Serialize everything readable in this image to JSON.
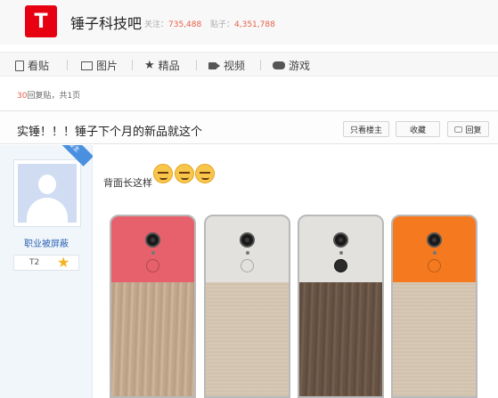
{
  "header": {
    "logo_letter": "T",
    "logo_color": "#e60012",
    "forum_name": "锤子科技吧",
    "follow_label": "关注：",
    "follow_count": "735,488",
    "posts_label": "贴子：",
    "posts_count": "4,351,788"
  },
  "nav": {
    "items": [
      {
        "label": "看贴",
        "icon": "document-icon"
      },
      {
        "label": "图片",
        "icon": "picture-icon"
      },
      {
        "label": "精品",
        "icon": "star-icon"
      },
      {
        "label": "视频",
        "icon": "video-icon"
      },
      {
        "label": "游戏",
        "icon": "gamepad-icon"
      }
    ]
  },
  "thread_meta": {
    "reply_count": "30",
    "reply_label": "回复贴，共1页"
  },
  "thread": {
    "title": "实锤！！！锤子下个月的新品就这个",
    "buttons": {
      "only_host": "只看楼主",
      "favorite": "收藏",
      "reply": "回复"
    }
  },
  "author": {
    "name": "职业被屏蔽",
    "level": "T2",
    "badge": "楼主"
  },
  "post": {
    "text": "背面长这样",
    "emoji_count": 3,
    "phones": [
      {
        "top_color": "#e6616b",
        "bottom": "light-wood"
      },
      {
        "top_color": "#e3e1de",
        "bottom": "beige-canvas"
      },
      {
        "top_color": "#e3e1de",
        "bottom": "dark-wood"
      },
      {
        "top_color": "#f57a1f",
        "bottom": "beige-canvas"
      }
    ]
  }
}
